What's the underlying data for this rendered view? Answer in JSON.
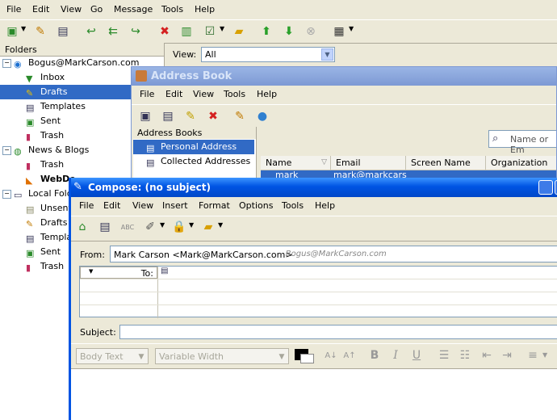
{
  "main": {
    "menu": [
      "File",
      "Edit",
      "View",
      "Go",
      "Message",
      "Tools",
      "Help"
    ],
    "folders_header": "Folders",
    "view_label": "View:",
    "view_value": "All",
    "folders": [
      {
        "label": "Bogus@MarkCarson.com",
        "level": 0,
        "bold": false
      },
      {
        "label": "Inbox",
        "level": 1
      },
      {
        "label": "Drafts",
        "level": 1,
        "selected": true
      },
      {
        "label": "Templates",
        "level": 1
      },
      {
        "label": "Sent",
        "level": 1
      },
      {
        "label": "Trash",
        "level": 1
      },
      {
        "label": "News & Blogs",
        "level": 0
      },
      {
        "label": "Trash",
        "level": 1
      },
      {
        "label": "WebDe",
        "level": 1,
        "bold": true
      },
      {
        "label": "Local Folde",
        "level": 0
      },
      {
        "label": "Unsent",
        "level": 1
      },
      {
        "label": "Drafts",
        "level": 1
      },
      {
        "label": "Templa",
        "level": 1
      },
      {
        "label": "Sent",
        "level": 1
      },
      {
        "label": "Trash",
        "level": 1
      }
    ]
  },
  "address_book": {
    "title": "Address Book",
    "menu": [
      "File",
      "Edit",
      "View",
      "Tools",
      "Help"
    ],
    "books_header": "Address Books",
    "books": [
      "Personal Address Book",
      "Collected Addresses"
    ],
    "search_placeholder": "Name or Em",
    "columns": [
      "Name",
      "Email",
      "Screen Name",
      "Organization"
    ],
    "row_name": "mark",
    "row_email": "mark@markcars"
  },
  "compose": {
    "title": "Compose: (no subject)",
    "menu": [
      "File",
      "Edit",
      "View",
      "Insert",
      "Format",
      "Options",
      "Tools",
      "Help"
    ],
    "from_label": "From:",
    "from_value": "Mark Carson <Mark@MarkCarson.com>",
    "from_account": "- Bogus@MarkCarson.com",
    "to_label": "To:",
    "subject_label": "Subject:",
    "format_style": "Body Text",
    "format_font": "Variable Width"
  },
  "colors": {
    "selection": "#316ac5",
    "title_active": "#0054e3",
    "toolbar_bg": "#ece9d8"
  }
}
